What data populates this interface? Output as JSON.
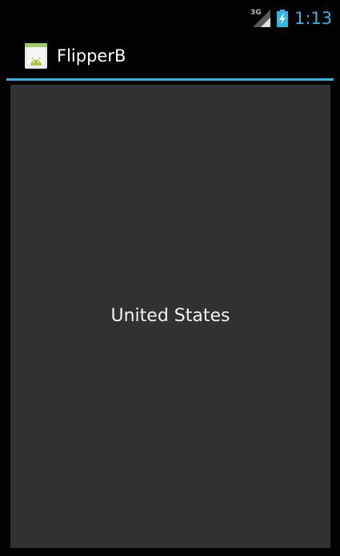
{
  "status_bar": {
    "network_type": "3G",
    "time": "1:13",
    "signal_icon": "signal-strength-icon",
    "battery_icon": "battery-charging-icon",
    "accent_color": "#33b5e5"
  },
  "action_bar": {
    "title": "FlipperB",
    "app_icon": "android-app-icon"
  },
  "flipper": {
    "current_item": "United States",
    "background_color": "#303231"
  }
}
